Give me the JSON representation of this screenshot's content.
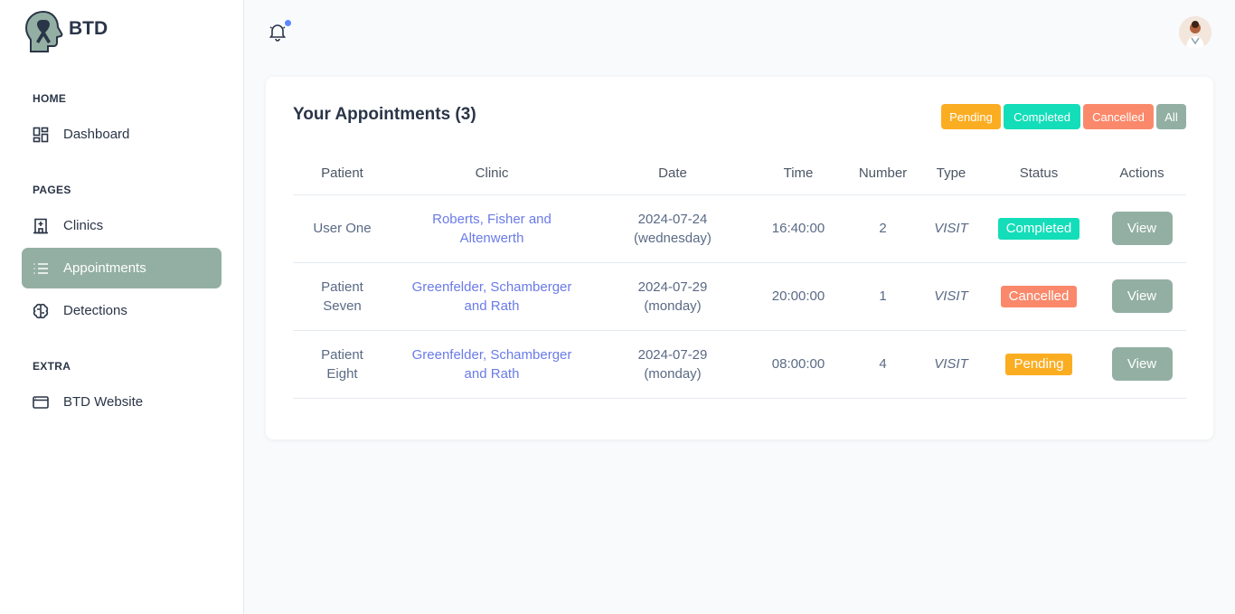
{
  "brand": {
    "name": "BTD"
  },
  "sidebar": {
    "sections": [
      {
        "title": "HOME"
      },
      {
        "title": "PAGES"
      },
      {
        "title": "EXTRA"
      }
    ],
    "items": [
      {
        "label": "Dashboard",
        "icon": "dashboard-icon"
      },
      {
        "label": "Clinics",
        "icon": "clinic-building-icon"
      },
      {
        "label": "Appointments",
        "icon": "list-icon",
        "active": true
      },
      {
        "label": "Detections",
        "icon": "brain-icon"
      },
      {
        "label": "BTD Website",
        "icon": "browser-window-icon"
      }
    ]
  },
  "colors": {
    "accent": "#93afa3",
    "pending": "#fbad22",
    "completed": "#13deb9",
    "cancelled": "#fa896b",
    "all": "#93afa3",
    "link": "#6a7be8"
  },
  "card": {
    "title": "Your Appointments (3)",
    "filters": [
      "Pending",
      "Completed",
      "Cancelled",
      "All"
    ]
  },
  "table": {
    "headers": [
      "Patient",
      "Clinic",
      "Date",
      "Time",
      "Number",
      "Type",
      "Status",
      "Actions"
    ],
    "rows": [
      {
        "patient_line1": "User One",
        "patient_line2": "",
        "clinic_line1": "Roberts, Fisher and",
        "clinic_line2": "Altenwerth",
        "date": "2024-07-24",
        "day": "(wednesday)",
        "time": "16:40:00",
        "number": "2",
        "type": "VISIT",
        "status": "Completed",
        "action": "View"
      },
      {
        "patient_line1": "Patient",
        "patient_line2": "Seven",
        "clinic_line1": "Greenfelder, Schamberger",
        "clinic_line2": "and Rath",
        "date": "2024-07-29",
        "day": "(monday)",
        "time": "20:00:00",
        "number": "1",
        "type": "VISIT",
        "status": "Cancelled",
        "action": "View"
      },
      {
        "patient_line1": "Patient",
        "patient_line2": "Eight",
        "clinic_line1": "Greenfelder, Schamberger",
        "clinic_line2": "and Rath",
        "date": "2024-07-29",
        "day": "(monday)",
        "time": "08:00:00",
        "number": "4",
        "type": "VISIT",
        "status": "Pending",
        "action": "View"
      }
    ]
  }
}
